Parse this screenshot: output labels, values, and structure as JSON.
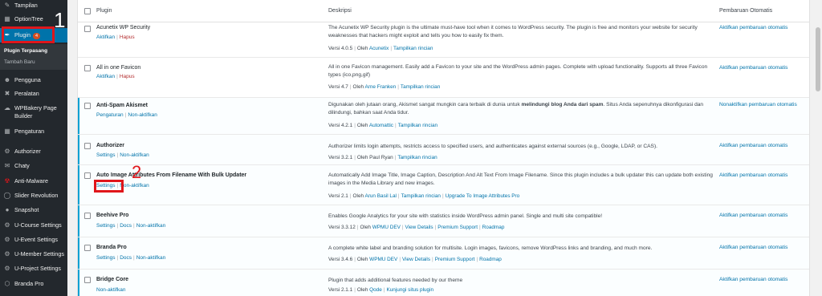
{
  "sidebar": {
    "items": [
      {
        "label": "Tampilan",
        "icon": "paintbrush-icon"
      },
      {
        "label": "OptionTree",
        "icon": "grid-icon"
      },
      {
        "label": "Plugin",
        "icon": "plugin-icon",
        "badge": "4"
      },
      {
        "label": "Pengguna",
        "icon": "users-icon"
      },
      {
        "label": "Peralatan",
        "icon": "wrench-icon"
      },
      {
        "label": "WPBakery Page Builder",
        "icon": "wpbakery-icon"
      },
      {
        "label": "Pengaturan",
        "icon": "settings-icon"
      },
      {
        "label": "Authorizer",
        "icon": "gear-icon"
      },
      {
        "label": "Chaty",
        "icon": "chat-icon"
      },
      {
        "label": "Anti-Malware",
        "icon": "malware-icon"
      },
      {
        "label": "Slider Revolution",
        "icon": "slider-icon"
      },
      {
        "label": "Snapshot",
        "icon": "snapshot-icon"
      },
      {
        "label": "U-Course Settings",
        "icon": "gear-icon"
      },
      {
        "label": "U-Event Settings",
        "icon": "gear-icon"
      },
      {
        "label": "U-Member Settings",
        "icon": "gear-icon"
      },
      {
        "label": "U-Project Settings",
        "icon": "gear-icon"
      },
      {
        "label": "Branda Pro",
        "icon": "branda-icon"
      }
    ],
    "submenu": [
      "Plugin Terpasang",
      "Tambah Baru"
    ]
  },
  "annotations": {
    "step1": "1",
    "step2": "2"
  },
  "table": {
    "headers": {
      "plugin": "Plugin",
      "description": "Deskripsi",
      "auto": "Pembaruan Otomatis"
    },
    "rows": [
      {
        "name": "Acunetix WP Security",
        "actions": [
          "Aktifkan",
          "Hapus"
        ],
        "description": "The Acunetix WP Security plugin is the ultimate must-have tool when it comes to WordPress security. The plugin is free and monitors your website for security weaknesses that hackers might exploit and tells you how to easily fix them.",
        "version": "Versi 4.0.5",
        "by": "Oleh",
        "author": "Acunetix",
        "links": [
          "Tampilkan rincian"
        ],
        "auto": "Aktifkan pembaruan otomatis"
      },
      {
        "name": "All in one Favicon",
        "actions": [
          "Aktifkan",
          "Hapus"
        ],
        "description": "All in one Favicon management. Easily add a Favicon to your site and the WordPress admin pages. Complete with upload functionality. Supports all three Favicon types (ico,png,gif)",
        "version": "Versi 4.7",
        "by": "Oleh",
        "author": "Arne Franken",
        "links": [
          "Tampilkan rincian"
        ],
        "auto": "Aktifkan pembaruan otomatis"
      },
      {
        "name": "Anti-Spam Akismet",
        "actions": [
          "Pengaturan",
          "Non-aktifkan"
        ],
        "description_pre": "Digunakan oleh jutaan orang, Akismet sangat mungkin cara terbaik di dunia untuk ",
        "description_bold": "melindungi blog Anda dari spam",
        "description_post": ". Situs Anda sepenuhnya dikonfigurasi dan dilindungi, bahkan saat Anda tidur.",
        "version": "Versi 4.2.1",
        "by": "Oleh",
        "author": "Automattic",
        "links": [
          "Tampilkan rincian"
        ],
        "auto": "Nonaktifkan pembaruan otomatis"
      },
      {
        "name": "Authorizer",
        "actions": [
          "Settings",
          "Non-aktifkan"
        ],
        "description": "Authorizer limits login attempts, restricts access to specified users, and authenticates against external sources (e.g., Google, LDAP, or CAS).",
        "version": "Versi 3.2.1",
        "by": "Oleh Paul Ryan",
        "author": "",
        "links": [
          "Tampilkan rincian"
        ],
        "auto": "Aktifkan pembaruan otomatis"
      },
      {
        "name": "Auto Image Attributes From Filename With Bulk Updater",
        "actions": [
          "Settings",
          "Non-aktifkan"
        ],
        "description": "Automatically Add Image Title, Image Caption, Description And Alt Text From Image Filename. Since this plugin includes a bulk updater this can update both existing images in the Media Library and new images.",
        "version": "Versi 2.1",
        "by": "Oleh",
        "author": "Arun Basil Lal",
        "links": [
          "Tampilkan rincian",
          "Upgrade To Image Attributes Pro"
        ],
        "auto": "Aktifkan pembaruan otomatis"
      },
      {
        "name": "Beehive Pro",
        "actions": [
          "Settings",
          "Docs",
          "Non-aktifkan"
        ],
        "description": "Enables Google Analytics for your site with statistics inside WordPress admin panel. Single and multi site compatible!",
        "version": "Versi 3.3.12",
        "by": "Oleh",
        "author": "WPMU DEV",
        "links": [
          "View Details",
          "Premium Support",
          "Roadmap"
        ],
        "auto": "Aktifkan pembaruan otomatis"
      },
      {
        "name": "Branda Pro",
        "actions": [
          "Settings",
          "Docs",
          "Non-aktifkan"
        ],
        "description": "A complete white label and branding solution for multisite. Login images, favicons, remove WordPress links and branding, and much more.",
        "version": "Versi 3.4.6",
        "by": "Oleh",
        "author": "WPMU DEV",
        "links": [
          "View Details",
          "Premium Support",
          "Roadmap"
        ],
        "auto": "Aktifkan pembaruan otomatis"
      },
      {
        "name": "Bridge Core",
        "actions": [
          "Non-aktifkan"
        ],
        "description": "Plugin that adds additional features needed by our theme",
        "version": "Versi 2.1.1",
        "by": "Oleh",
        "author": "Qode",
        "links": [
          "Kunjungi situs plugin"
        ],
        "auto": "Aktifkan pembaruan otomatis"
      }
    ]
  },
  "colors": {
    "sidebar": "#23282d",
    "active": "#0073aa",
    "link": "#0073aa",
    "annotation": "#e0161b",
    "activeRowBorder": "#00a0d2"
  }
}
